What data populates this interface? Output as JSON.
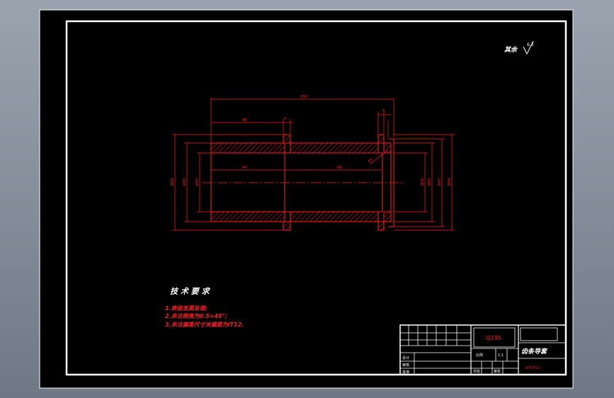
{
  "drawing": {
    "roughness_symbol": {
      "prefix": "其余",
      "value": "6.3"
    },
    "dimensions": {
      "overall_length": "156",
      "left_segment": "48",
      "groove_width": "4",
      "right_groove": "4",
      "bore_left": "44",
      "bore_right": "68",
      "chamfer_note": "45°",
      "left_diameters": [
        "Ø60",
        "Ø45",
        "Ø35"
      ],
      "right_diameters": [
        "Ø36",
        "Ø45",
        "Ø47",
        "Ø48"
      ]
    },
    "colors": {
      "background": "#000000",
      "frame": "#ffffff",
      "dimension": "#ff2020",
      "part": "#ff2020",
      "centerline": "#ff2020"
    }
  },
  "tech_requirements": {
    "title": "技 术 要 求",
    "items": [
      "1.表面发黑处理;",
      "2.未注倒角为0.5×45°;",
      "3.未注偏差尺寸关偏差为IT12."
    ]
  },
  "title_block": {
    "material": "Q235",
    "part_name": "齿条导套",
    "drawing_number": "GYQT-CJ",
    "scale_label": "比例",
    "scale_value": "1:1",
    "quantity_label": "共张",
    "sheet_label": "第张",
    "designer_label": "设计",
    "checker_label": "审核",
    "approve_label": "批准"
  }
}
